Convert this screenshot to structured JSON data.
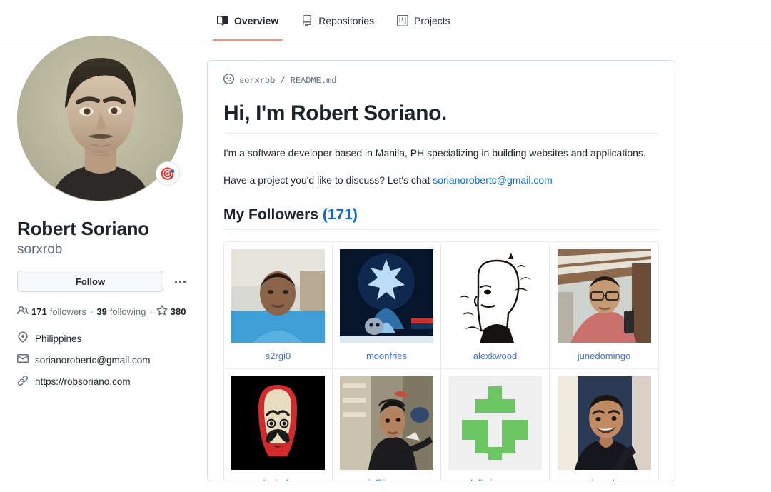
{
  "nav": {
    "tabs": [
      {
        "label": "Overview",
        "icon": "book-icon",
        "active": true
      },
      {
        "label": "Repositories",
        "icon": "repo-icon",
        "active": false
      },
      {
        "label": "Projects",
        "icon": "project-icon",
        "active": false
      }
    ]
  },
  "profile": {
    "avatar_alt": "portrait-painting-avatar",
    "status_emoji": "🎯",
    "fullname": "Robert Soriano",
    "username": "sorxrob",
    "follow_label": "Follow",
    "kebab_label": "More options",
    "stats": {
      "followers_count": "171",
      "followers_label": "followers",
      "separator": "·",
      "following_count": "39",
      "following_label": "following",
      "stars_count": "380"
    },
    "meta": [
      {
        "icon": "location-icon",
        "text": "Philippines"
      },
      {
        "icon": "mail-icon",
        "text": "sorianorobertc@gmail.com"
      },
      {
        "icon": "link-icon",
        "text": "https://robsoriano.com"
      }
    ]
  },
  "readme": {
    "crumb_user": "sorxrob",
    "crumb_sep": "/",
    "crumb_file": "README.md",
    "crumb_icon": "smiley-icon",
    "heading": "Hi, I'm Robert Soriano.",
    "paragraph1": "I'm a software developer based in Manila, PH specializing in building websites and applications.",
    "paragraph2_prefix": "Have a project you'd like to discuss? Let's chat ",
    "paragraph2_link": "sorianorobertc@gmail.com",
    "followers_heading": "My Followers ",
    "followers_open_paren": "(",
    "followers_count": "171",
    "followers_close_paren": ")"
  },
  "followers": [
    {
      "name": "s2rgi0",
      "avatar": "selfie-blue-shirt"
    },
    {
      "name": "moonfries",
      "avatar": "blue-game-character"
    },
    {
      "name": "alexkwood",
      "avatar": "bw-illustration-birds"
    },
    {
      "name": "junedomingo",
      "avatar": "selfie-pink-shirt-glasses"
    },
    {
      "name": "ckmirafss",
      "avatar": "dali-mask-red-hood"
    },
    {
      "name": "jofftiquez",
      "avatar": "rock-climber"
    },
    {
      "name": "kdbcinco-cs",
      "avatar": "green-pixel-logo"
    },
    {
      "name": "timrodz",
      "avatar": "smiling-man-dark-shirt"
    }
  ],
  "colors": {
    "accent": "#0969da",
    "active_tab_underline": "#fd8c73",
    "link": "#4a72b8",
    "border": "#d8dee4",
    "muted_text": "#636c76"
  }
}
